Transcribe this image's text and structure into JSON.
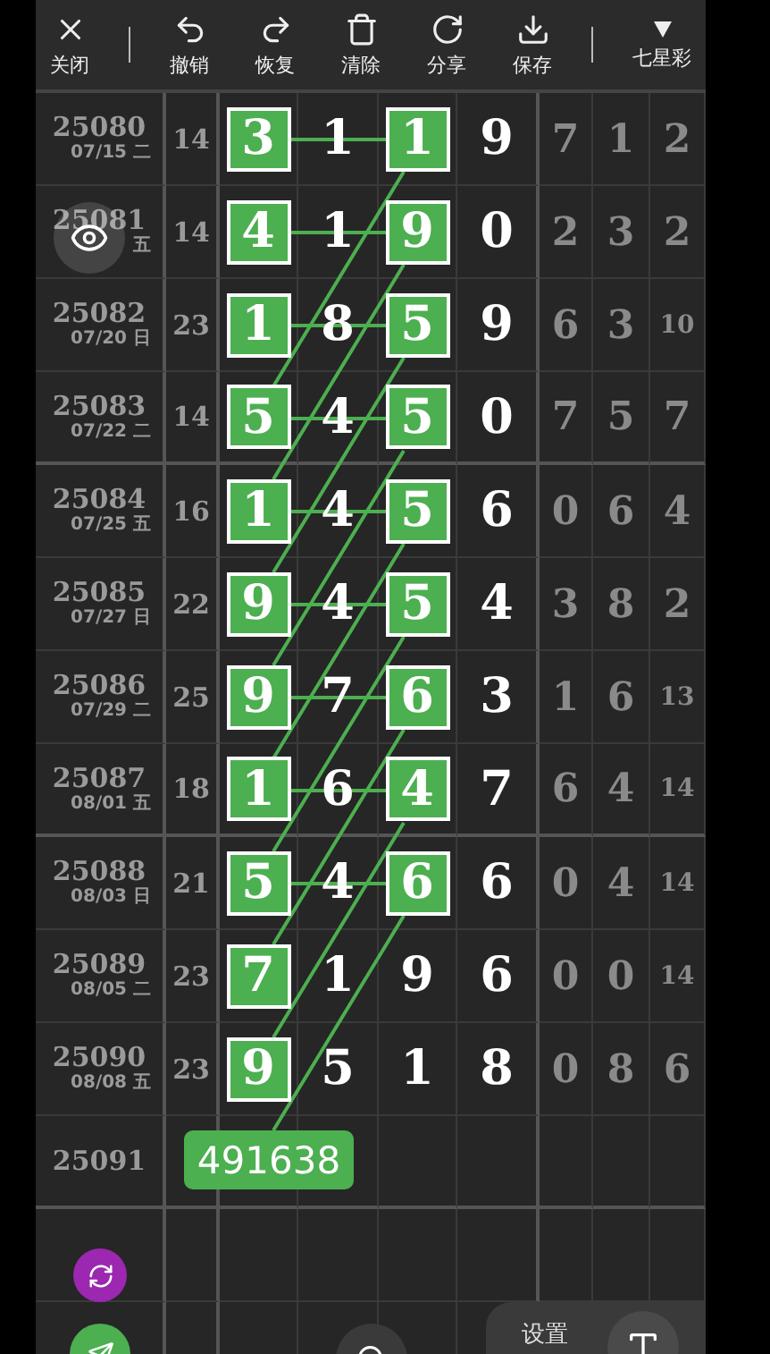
{
  "toolbar": [
    {
      "kind": "action",
      "label": "关闭"
    },
    {
      "kind": "action",
      "label": "撤销"
    },
    {
      "kind": "action",
      "label": "恢复"
    },
    {
      "kind": "action",
      "label": "清除"
    },
    {
      "kind": "action",
      "label": "分享"
    },
    {
      "kind": "action",
      "label": "保存"
    },
    {
      "kind": "dropdown",
      "label": "七星彩"
    }
  ],
  "rows": [
    {
      "issue": "25080",
      "date": "07/15 二",
      "sum": "14",
      "digits": [
        {
          "value": "3",
          "boxed": true
        },
        {
          "value": "1",
          "boxed": false
        },
        {
          "value": "1",
          "boxed": true
        },
        {
          "value": "9",
          "boxed": false
        }
      ],
      "extras": [
        "7",
        "1",
        "2"
      ]
    },
    {
      "issue": "25081",
      "date": "五",
      "sum": "14",
      "digits": [
        {
          "value": "4",
          "boxed": true
        },
        {
          "value": "1",
          "boxed": false
        },
        {
          "value": "9",
          "boxed": true
        },
        {
          "value": "0",
          "boxed": false
        }
      ],
      "extras": [
        "2",
        "3",
        "2"
      ]
    },
    {
      "issue": "25082",
      "date": "07/20 日",
      "sum": "23",
      "digits": [
        {
          "value": "1",
          "boxed": true
        },
        {
          "value": "8",
          "boxed": false
        },
        {
          "value": "5",
          "boxed": true
        },
        {
          "value": "9",
          "boxed": false
        }
      ],
      "extras": [
        "6",
        "3",
        "10"
      ]
    },
    {
      "issue": "25083",
      "date": "07/22 二",
      "sum": "14",
      "digits": [
        {
          "value": "5",
          "boxed": true
        },
        {
          "value": "4",
          "boxed": false
        },
        {
          "value": "5",
          "boxed": true
        },
        {
          "value": "0",
          "boxed": false
        }
      ],
      "extras": [
        "7",
        "5",
        "7"
      ]
    },
    {
      "issue": "25084",
      "date": "07/25 五",
      "sum": "16",
      "digits": [
        {
          "value": "1",
          "boxed": true
        },
        {
          "value": "4",
          "boxed": false
        },
        {
          "value": "5",
          "boxed": true
        },
        {
          "value": "6",
          "boxed": false
        }
      ],
      "extras": [
        "0",
        "6",
        "4"
      ]
    },
    {
      "issue": "25085",
      "date": "07/27 日",
      "sum": "22",
      "digits": [
        {
          "value": "9",
          "boxed": true
        },
        {
          "value": "4",
          "boxed": false
        },
        {
          "value": "5",
          "boxed": true
        },
        {
          "value": "4",
          "boxed": false
        }
      ],
      "extras": [
        "3",
        "8",
        "2"
      ]
    },
    {
      "issue": "25086",
      "date": "07/29 二",
      "sum": "25",
      "digits": [
        {
          "value": "9",
          "boxed": true
        },
        {
          "value": "7",
          "boxed": false
        },
        {
          "value": "6",
          "boxed": true
        },
        {
          "value": "3",
          "boxed": false
        }
      ],
      "extras": [
        "1",
        "6",
        "13"
      ]
    },
    {
      "issue": "25087",
      "date": "08/01 五",
      "sum": "18",
      "digits": [
        {
          "value": "1",
          "boxed": true
        },
        {
          "value": "6",
          "boxed": false
        },
        {
          "value": "4",
          "boxed": true
        },
        {
          "value": "7",
          "boxed": false
        }
      ],
      "extras": [
        "6",
        "4",
        "14"
      ]
    },
    {
      "issue": "25088",
      "date": "08/03 日",
      "sum": "21",
      "digits": [
        {
          "value": "5",
          "boxed": true
        },
        {
          "value": "4",
          "boxed": false
        },
        {
          "value": "6",
          "boxed": true
        },
        {
          "value": "6",
          "boxed": false
        }
      ],
      "extras": [
        "0",
        "4",
        "14"
      ]
    },
    {
      "issue": "25089",
      "date": "08/05 二",
      "sum": "23",
      "digits": [
        {
          "value": "7",
          "boxed": true
        },
        {
          "value": "1",
          "boxed": false
        },
        {
          "value": "9",
          "boxed": false
        },
        {
          "value": "6",
          "boxed": false
        }
      ],
      "extras": [
        "0",
        "0",
        "14"
      ]
    },
    {
      "issue": "25090",
      "date": "08/08 五",
      "sum": "23",
      "digits": [
        {
          "value": "9",
          "boxed": true
        },
        {
          "value": "5",
          "boxed": false
        },
        {
          "value": "1",
          "boxed": false
        },
        {
          "value": "8",
          "boxed": false
        }
      ],
      "extras": [
        "0",
        "8",
        "6"
      ]
    },
    {
      "issue": "25091"
    }
  ],
  "prediction": "491638",
  "settings_panel": {
    "label": "设置"
  }
}
